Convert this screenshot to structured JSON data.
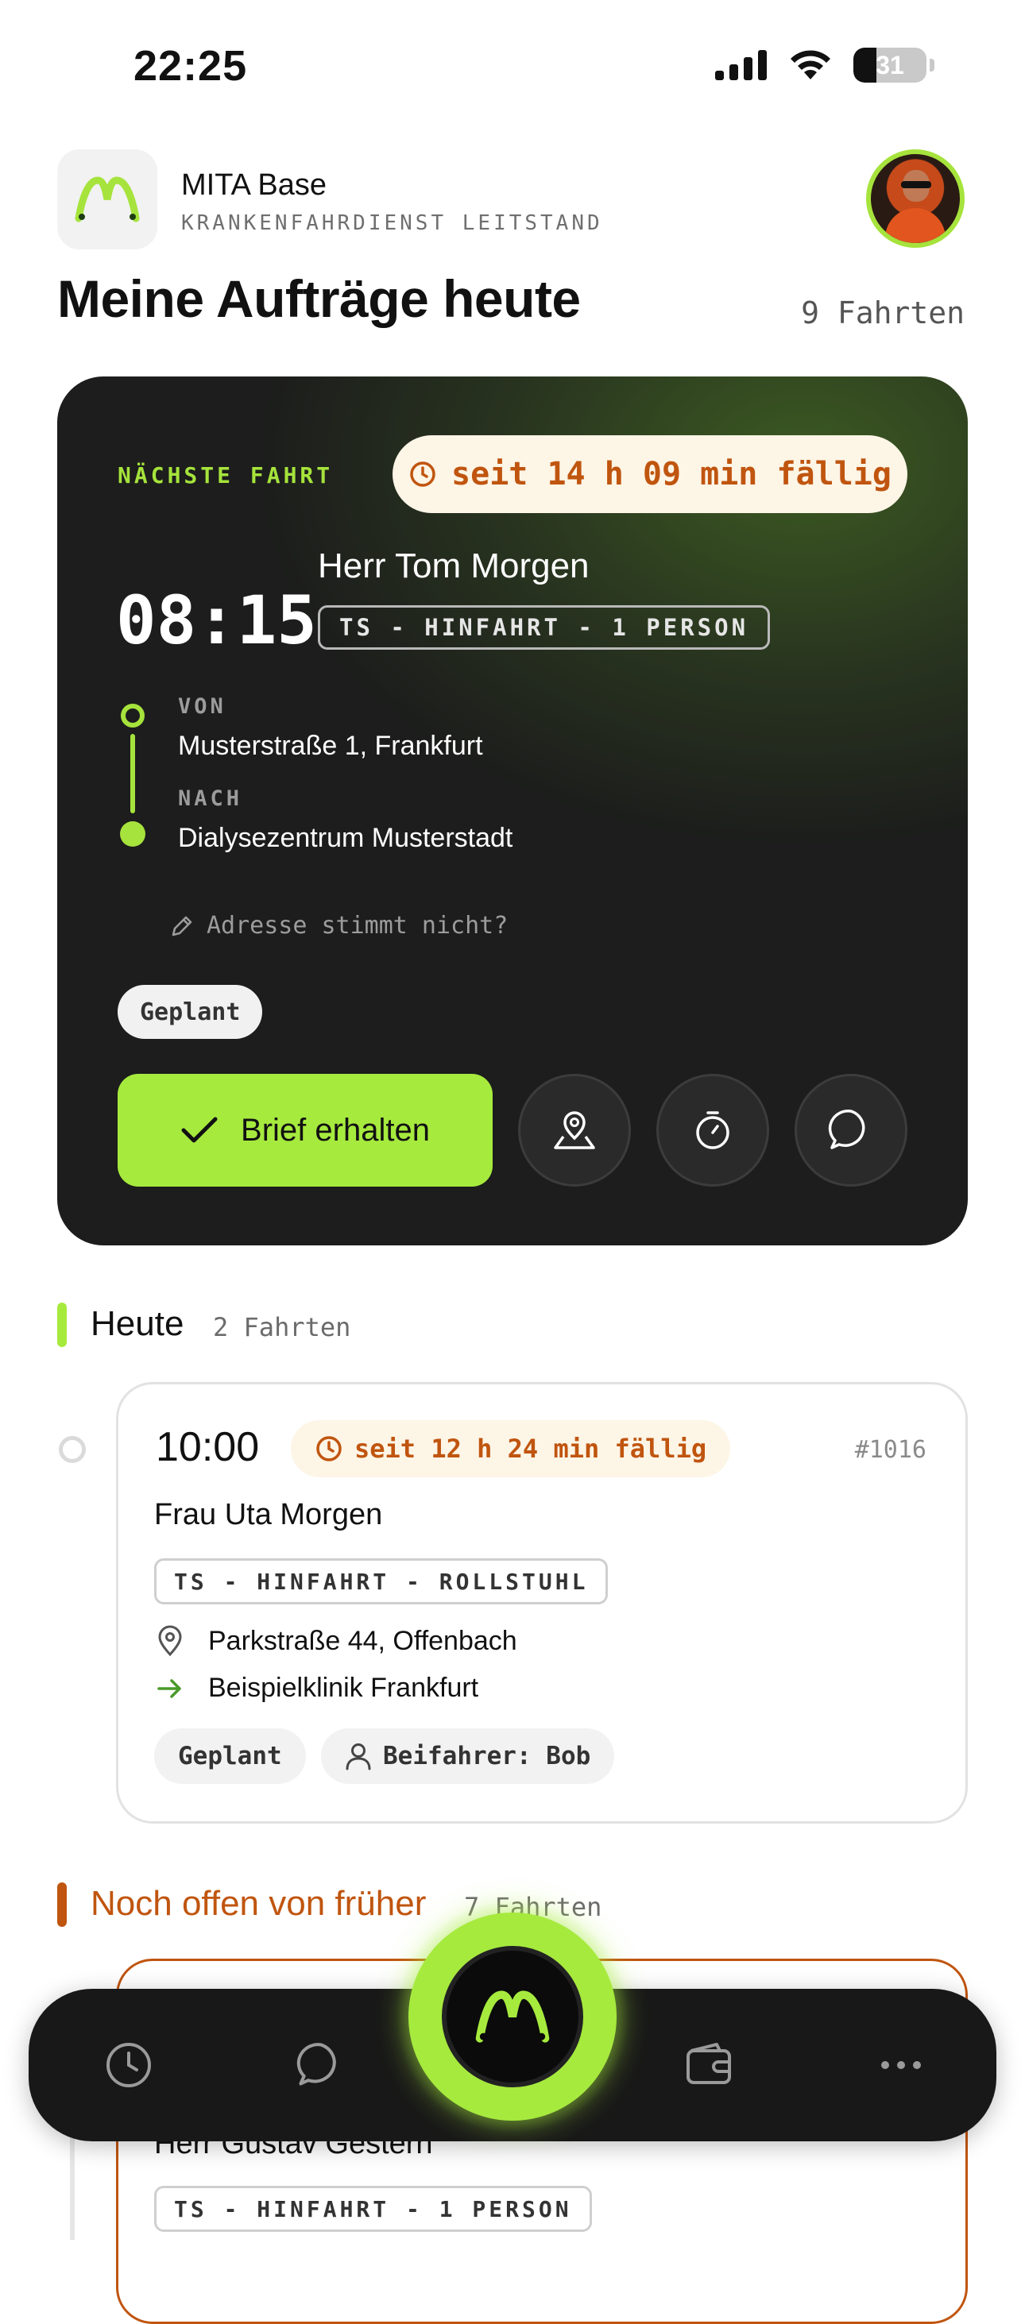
{
  "status_bar": {
    "time": "22:25",
    "battery": "31",
    "battery_level": 0.31
  },
  "header": {
    "app_name": "MITA Base",
    "app_subtitle": "KRANKENFAHRDIENST LEITSTAND",
    "page_title": "Meine Aufträge heute",
    "trip_count": "9 Fahrten"
  },
  "next_trip": {
    "label": "NÄCHSTE FAHRT",
    "due": "seit 14 h 09 min fällig",
    "time": "08:15",
    "patient": "Herr Tom Morgen",
    "tag": "TS - HINFAHRT - 1 PERSON",
    "from_label": "VON",
    "from": "Musterstraße 1, Frankfurt",
    "to_label": "NACH",
    "to": "Dialysezentrum Musterstadt",
    "address_wrong": "Adresse stimmt nicht?",
    "status": "Geplant",
    "primary_action": "Brief erhalten"
  },
  "today": {
    "title": "Heute",
    "count": "2 Fahrten",
    "trips": [
      {
        "time": "10:00",
        "due": "seit 12 h 24 min fällig",
        "id": "#1016",
        "patient": "Frau Uta Morgen",
        "tag": "TS - HINFAHRT - ROLLSTUHL",
        "from": "Parkstraße 44, Offenbach",
        "to": "Beispielklinik Frankfurt",
        "status": "Geplant",
        "codriver": "Beifahrer: Bob"
      }
    ]
  },
  "overdue": {
    "title": "Noch offen von früher",
    "count": "7 Fahrten",
    "first_trip": {
      "patient": "Herr Gustav Gestern",
      "tag": "TS - HINFAHRT - 1 PERSON"
    }
  },
  "colors": {
    "accent": "#a6ea3e",
    "warning": "#c0550f",
    "card_dark": "#1c1d1c"
  },
  "nav_icons": [
    "clock-icon",
    "chat-icon",
    "mita-logo-icon",
    "wallet-icon",
    "more-icon"
  ]
}
